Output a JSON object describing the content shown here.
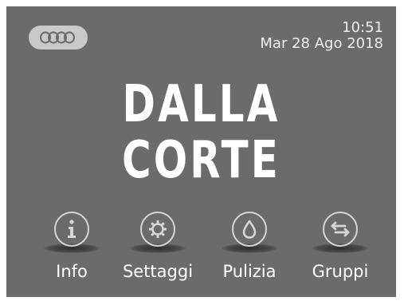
{
  "header": {
    "time": "10:51",
    "date": "Mar 28 Ago 2018",
    "status_icon": "rings-icon"
  },
  "logo": {
    "line1": "DALLA",
    "line2": "CORTE"
  },
  "menu": {
    "items": [
      {
        "label": "Info",
        "icon": "info-icon"
      },
      {
        "label": "Settaggi",
        "icon": "gear-icon"
      },
      {
        "label": "Pulizia",
        "icon": "drop-icon"
      },
      {
        "label": "Gruppi",
        "icon": "swap-arrows-icon"
      }
    ]
  },
  "colors": {
    "background": "#6b6b6b",
    "text": "#ffffff",
    "icon": "#d6d6d6",
    "pill": "#c9c9c9"
  }
}
